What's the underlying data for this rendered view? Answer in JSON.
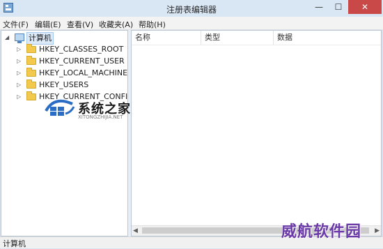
{
  "window": {
    "title": "注册表编辑器",
    "controls": {
      "minimize": "—",
      "maximize": "☐",
      "close": "✕"
    }
  },
  "menu": [
    "文件(F)",
    "编辑(E)",
    "查看(V)",
    "收藏夹(A)",
    "帮助(H)"
  ],
  "tree": {
    "root": {
      "label": "计算机",
      "expanded": true,
      "icon": "computer-icon"
    },
    "children": [
      {
        "label": "HKEY_CLASSES_ROOT",
        "icon": "folder-icon"
      },
      {
        "label": "HKEY_CURRENT_USER",
        "icon": "folder-icon"
      },
      {
        "label": "HKEY_LOCAL_MACHINE",
        "icon": "folder-icon"
      },
      {
        "label": "HKEY_USERS",
        "icon": "folder-icon"
      },
      {
        "label": "HKEY_CURRENT_CONFIG",
        "icon": "folder-icon"
      }
    ]
  },
  "columns": [
    "名称",
    "类型",
    "数据"
  ],
  "statusbar": {
    "path": "计算机"
  },
  "watermarks": {
    "site1": {
      "title": "系统之家",
      "subtitle": "XITONGZHIJIA.NET"
    },
    "site2": "威航软件园"
  },
  "colors": {
    "titlebar": "#d9e6f4",
    "close": "#c94848",
    "accent": "#6b3aa8"
  }
}
